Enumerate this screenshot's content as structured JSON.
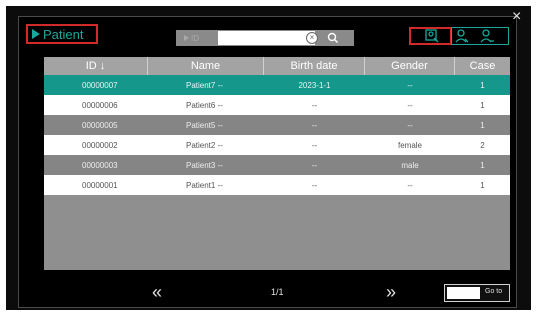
{
  "dialog": {
    "title": "Patient",
    "close_glyph": "×"
  },
  "search": {
    "prefix_label": "ID",
    "value": "",
    "placeholder": "",
    "clear_icon": "clear-icon",
    "search_icon": "search-icon"
  },
  "toolbar": {
    "icons": [
      "patient-search-icon",
      "user-icon",
      "add-user-icon"
    ],
    "accent_color": "#1aa89a",
    "highlight_color": "#d22a2a"
  },
  "table": {
    "columns": [
      "ID ↓",
      "Name",
      "Birth date",
      "Gender",
      "Case"
    ],
    "rows": [
      {
        "id": "00000007",
        "name": "Patient7 --",
        "birth": "2023-1-1",
        "gender": "--",
        "case": "1",
        "style": "selected"
      },
      {
        "id": "00000006",
        "name": "Patient6 --",
        "birth": "--",
        "gender": "--",
        "case": "1",
        "style": "white"
      },
      {
        "id": "00000005",
        "name": "Patient5 --",
        "birth": "--",
        "gender": "--",
        "case": "1",
        "style": "gray"
      },
      {
        "id": "00000002",
        "name": "Patient2 --",
        "birth": "--",
        "gender": "female",
        "case": "2",
        "style": "white"
      },
      {
        "id": "00000003",
        "name": "Patient3 --",
        "birth": "--",
        "gender": "male",
        "case": "1",
        "style": "gray"
      },
      {
        "id": "00000001",
        "name": "Patient1 --",
        "birth": "--",
        "gender": "--",
        "case": "1",
        "style": "white"
      }
    ],
    "selected_color": "#15978b"
  },
  "pagination": {
    "prev_glyph": "«",
    "next_glyph": "»",
    "page_info": "1/1",
    "goto_label": "Go to",
    "goto_value": ""
  }
}
